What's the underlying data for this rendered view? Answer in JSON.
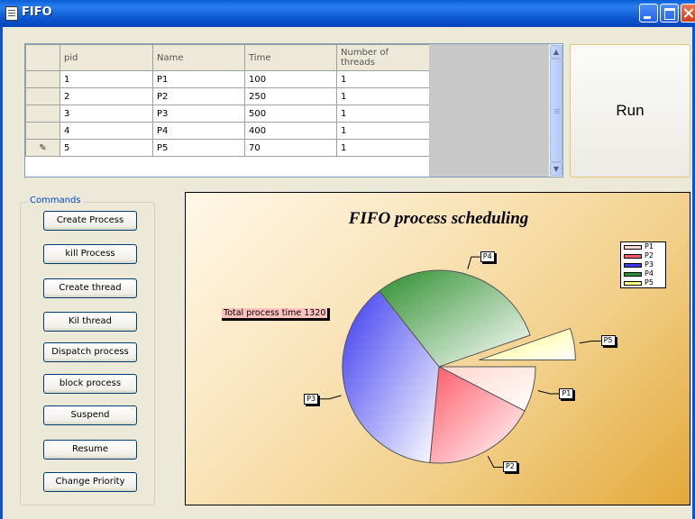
{
  "window": {
    "title": "FIFO"
  },
  "grid": {
    "headers": [
      "pid",
      "Name",
      "Time",
      "Number of threads"
    ],
    "rows": [
      {
        "marker": "",
        "pid": "1",
        "name": "P1",
        "time": "100",
        "threads": "1"
      },
      {
        "marker": "",
        "pid": "2",
        "name": "P2",
        "time": "250",
        "threads": "1"
      },
      {
        "marker": "",
        "pid": "3",
        "name": "P3",
        "time": "500",
        "threads": "1"
      },
      {
        "marker": "",
        "pid": "4",
        "name": "P4",
        "time": "400",
        "threads": "1"
      },
      {
        "marker": "✎",
        "pid": "5",
        "name": "P5",
        "time": "70",
        "threads": "1"
      }
    ]
  },
  "run_button": {
    "label": "Run"
  },
  "commands": {
    "legend": "Commands",
    "buttons": [
      "Create Process",
      "kill Process",
      "Create thread",
      "Kil thread",
      "Dispatch process",
      "block process",
      "Suspend",
      "Resume",
      "Change Priority"
    ]
  },
  "chart": {
    "total_label": "Total process time 1320"
  },
  "chart_data": {
    "type": "pie",
    "title": "FIFO process scheduling",
    "categories": [
      "P1",
      "P2",
      "P3",
      "P4",
      "P5"
    ],
    "values": [
      100,
      250,
      500,
      400,
      70
    ],
    "colors": [
      "#ffd7cc",
      "#ff5a68",
      "#3a3af0",
      "#2f8f2f",
      "#ffff80"
    ],
    "exploded": [
      "P5"
    ],
    "legend_position": "top-right",
    "annotation": "Total process time 1320"
  }
}
